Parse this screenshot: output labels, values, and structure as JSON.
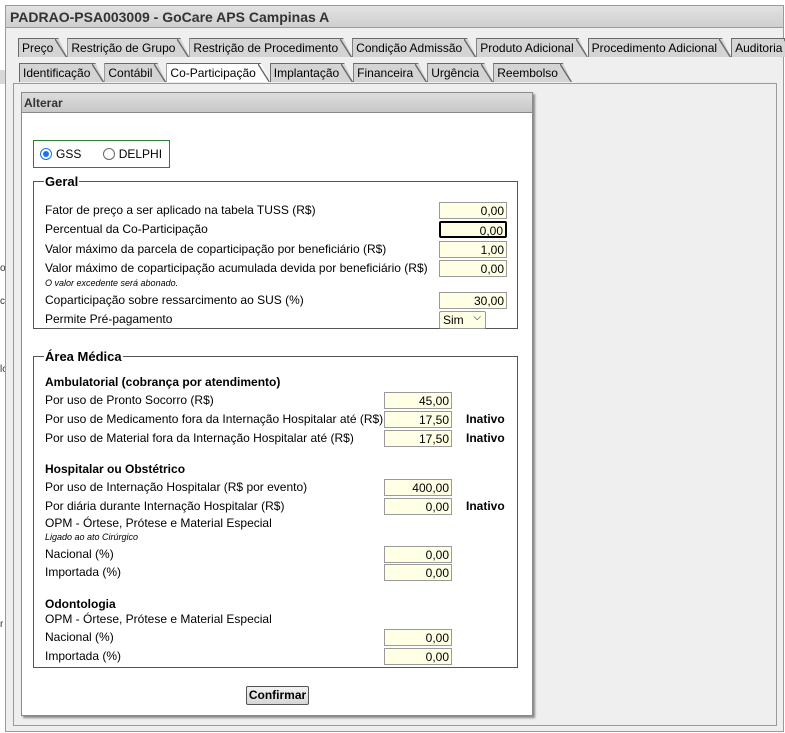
{
  "window": {
    "title": "PADRAO-PSA003009 - GoCare APS Campinas A"
  },
  "left_edge_marks": [
    "o",
    "c",
    "lc",
    "r"
  ],
  "tabs_row1": [
    "Preço",
    "Restrição de Grupo",
    "Restrição de Procedimento",
    "Condição Admissão",
    "Produto Adicional",
    "Procedimento Adicional",
    "Auditoria"
  ],
  "tabs_row2": [
    "Identificação",
    "Contábil",
    "Co-Participação",
    "Implantação",
    "Financeira",
    "Urgência",
    "Reembolso"
  ],
  "active_tab": "Co-Participação",
  "dialog": {
    "title": "Alterar",
    "radio": {
      "option1": "GSS",
      "option2": "DELPHI",
      "selected": "GSS"
    },
    "geral": {
      "legend": "Geral",
      "fator_label": "Fator de preço a ser aplicado na tabela TUSS (R$)",
      "fator_value": "0,00",
      "percentual_label": "Percentual da Co-Participação",
      "percentual_value": "0,00",
      "parcela_label": "Valor máximo da parcela de coparticipação por beneficiário (R$)",
      "parcela_value": "1,00",
      "acumulada_label": "Valor máximo de coparticipação acumulada devida por beneficiário (R$)",
      "acumulada_value": "0,00",
      "acumulada_note": "O valor excedente será abonado.",
      "sus_label": "Coparticipação sobre ressarcimento ao SUS (%)",
      "sus_value": "30,00",
      "prepag_label": "Permite Pré-pagamento",
      "prepag_value": "Sim"
    },
    "area_medica": {
      "legend": "Área Médica",
      "ambulatorial_title": "Ambulatorial (cobrança por atendimento)",
      "pronto_label": "Por uso de Pronto Socorro (R$)",
      "pronto_value": "45,00",
      "medicamento_label": "Por uso de Medicamento fora da Internação Hospitalar até (R$)",
      "medicamento_value": "17,50",
      "medicamento_status": "Inativo",
      "material_label": "Por uso de Material fora da Internação Hospitalar até (R$)",
      "material_value": "17,50",
      "material_status": "Inativo",
      "hospitalar_title": "Hospitalar ou Obstétrico",
      "internacao_label": "Por uso de Internação Hospitalar (R$ por evento)",
      "internacao_value": "400,00",
      "diaria_label": "Por diária durante Internação Hospitalar (R$)",
      "diaria_value": "0,00",
      "diaria_status": "Inativo",
      "opm_label": "OPM - Órtese, Prótese e Material Especial",
      "opm_note": "Ligado ao ato Cirúrgico",
      "nacional_label": "Nacional (%)",
      "nacional_value": "0,00",
      "importada_label": "Importada (%)",
      "importada_value": "0,00",
      "odonto_title": "Odontologia",
      "odonto_opm_label": "OPM - Órtese, Prótese e Material Especial",
      "odonto_nacional_label": "Nacional (%)",
      "odonto_nacional_value": "0,00",
      "odonto_importada_label": "Importada (%)",
      "odonto_importada_value": "0,00"
    },
    "confirm_label": "Confirmar"
  }
}
